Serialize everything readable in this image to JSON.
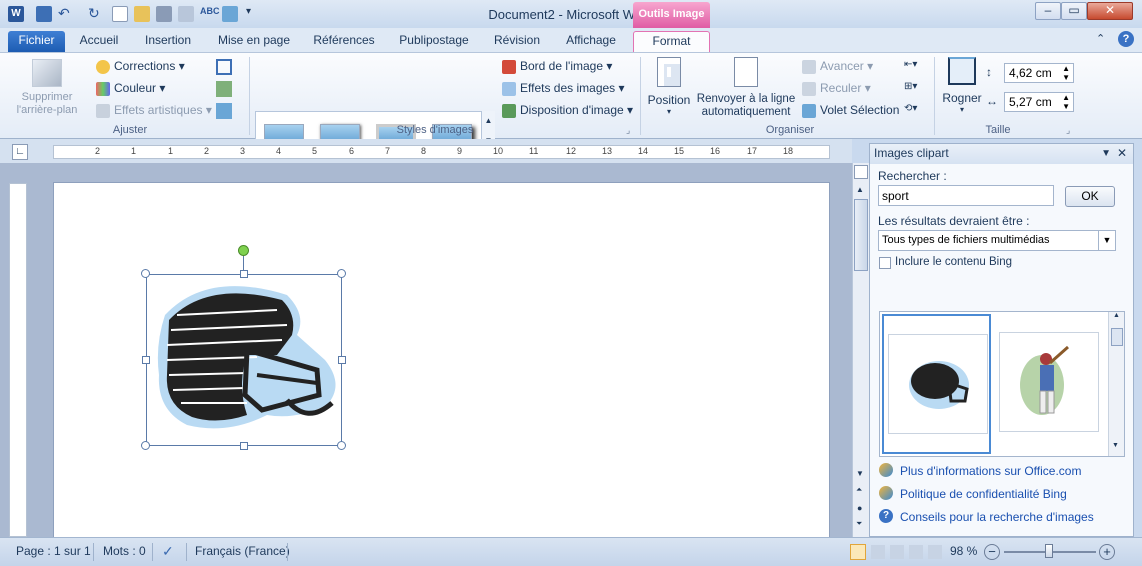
{
  "window": {
    "title": "Document2 - Microsoft Word",
    "context_tab": "Outils Image"
  },
  "tabs": [
    "Fichier",
    "Accueil",
    "Insertion",
    "Mise en page",
    "Références",
    "Publipostage",
    "Révision",
    "Affichage",
    "Format"
  ],
  "ribbon": {
    "ajuster": {
      "label": "Ajuster",
      "remove_bg": "Supprimer l'arrière-plan",
      "corrections": "Corrections",
      "couleur": "Couleur",
      "effets_artistiques": "Effets artistiques"
    },
    "styles": {
      "label": "Styles d'images",
      "bord": "Bord de l'image",
      "effets": "Effets des images",
      "disposition": "Disposition d'image"
    },
    "organiser": {
      "label": "Organiser",
      "position": "Position",
      "renvoyer": "Renvoyer à la ligne automatiquement",
      "avancer": "Avancer",
      "reculer": "Reculer",
      "volet": "Volet Sélection"
    },
    "taille": {
      "label": "Taille",
      "rogner": "Rogner",
      "height": "4,62 cm",
      "width": "5,27 cm"
    }
  },
  "ruler": {
    "marks": [
      "2",
      "1",
      "1",
      "2",
      "3",
      "4",
      "5",
      "6",
      "7",
      "8",
      "9",
      "10",
      "11",
      "12",
      "13",
      "14",
      "15",
      "16",
      "17",
      "18"
    ]
  },
  "pane": {
    "title": "Images clipart",
    "search_label": "Rechercher :",
    "search_value": "sport",
    "ok": "OK",
    "results_label": "Les résultats devraient être :",
    "results_value": "Tous types de fichiers multimédias",
    "bing_checkbox": "Inclure le contenu Bing",
    "links": [
      "Plus d'informations sur Office.com",
      "Politique de confidentialité Bing",
      "Conseils pour la recherche d'images"
    ]
  },
  "status": {
    "page": "Page : 1 sur 1",
    "mots": "Mots : 0",
    "langue": "Français (France)",
    "zoom": "98 %",
    "zoom_level": 0.49
  },
  "colors": {
    "accent": "#2b579a",
    "context": "#e05ca4"
  }
}
